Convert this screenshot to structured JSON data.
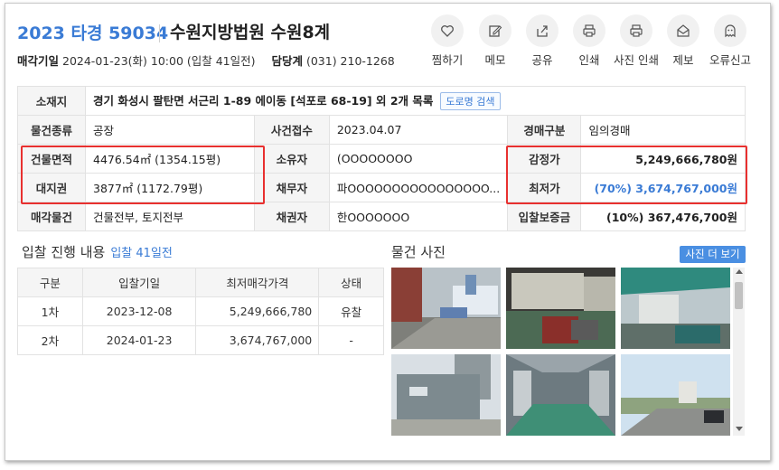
{
  "header": {
    "case_number": "2023 타경 59034",
    "court": "수원지방법원 수원8계",
    "sale_date_label": "매각기일",
    "sale_date_value": "2024-01-23(화) 10:00 (입찰 41일전)",
    "dept_label": "담당계",
    "dept_phone": "(031) 210-1268"
  },
  "actions": [
    {
      "label": "찜하기",
      "icon": "heart-icon"
    },
    {
      "label": "메모",
      "icon": "edit-icon"
    },
    {
      "label": "공유",
      "icon": "share-icon"
    },
    {
      "label": "인쇄",
      "icon": "print-icon"
    },
    {
      "label": "사진 인쇄",
      "icon": "print-icon"
    },
    {
      "label": "제보",
      "icon": "mail-icon"
    },
    {
      "label": "오류신고",
      "icon": "ghost-icon"
    }
  ],
  "info": {
    "location_label": "소재지",
    "location_value": "경기 화성시 팔탄면 서근리 1-89 에이동 [석포로 68-19] 외 2개 목록",
    "road_button": "도로명 검색",
    "type_label": "물건종류",
    "type_value": "공장",
    "case_date_label": "사건접수",
    "case_date_value": "2023.04.07",
    "auction_type_label": "경매구분",
    "auction_type_value": "임의경매",
    "building_area_label": "건물면적",
    "building_area_value": "4476.54㎡ (1354.15평)",
    "owner_label": "소유자",
    "owner_value": "(OOOOOOOO",
    "appraisal_label": "감정가",
    "appraisal_value": "5,249,666,780원",
    "land_right_label": "대지권",
    "land_right_value": "3877㎡ (1172.79평)",
    "debtor_label": "채무자",
    "debtor_value": "파OOOOOOOOOOOOOOOO...",
    "min_price_label": "최저가",
    "min_price_value": "(70%) 3,674,767,000원",
    "sale_items_label": "매각물건",
    "sale_items_value": "건물전부, 토지전부",
    "creditor_label": "채권자",
    "creditor_value": "한OOOOOOO",
    "deposit_label": "입찰보증금",
    "deposit_value": "(10%) 367,476,700원"
  },
  "bidding": {
    "title": "입찰 진행 내용",
    "subtitle": "입찰 41일전",
    "headers": [
      "구분",
      "입찰기일",
      "최저매각가격",
      "상태"
    ],
    "rows": [
      [
        "1차",
        "2023-12-08",
        "5,249,666,780",
        "유찰"
      ],
      [
        "2차",
        "2024-01-23",
        "3,674,767,000",
        "-"
      ]
    ]
  },
  "photos": {
    "title": "물건 사진",
    "more_button": "사진 더 보기"
  },
  "colors": {
    "accent": "#3a7bd5",
    "highlight_box": "#e8302f",
    "header_cell": "#f5f5f5"
  }
}
